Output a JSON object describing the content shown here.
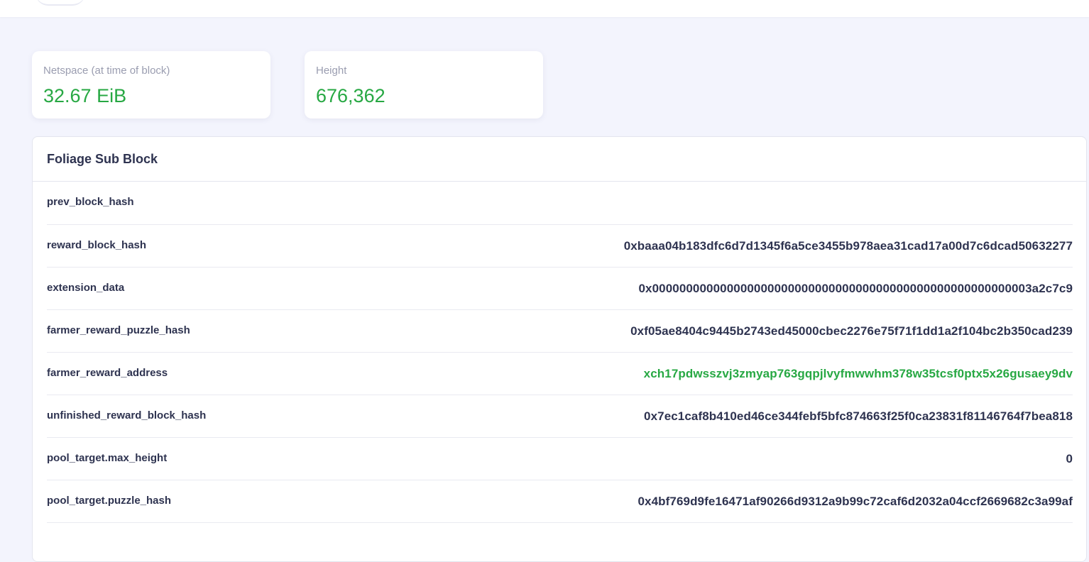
{
  "stats": {
    "netspace": {
      "label": "Netspace (at time of block)",
      "value": "32.67 EiB"
    },
    "height": {
      "label": "Height",
      "value": "676,362"
    }
  },
  "foliage": {
    "title": "Foliage Sub Block",
    "rows": [
      {
        "key": "prev_block_hash",
        "value": ""
      },
      {
        "key": "reward_block_hash",
        "value": "0xbaaa04b183dfc6d7d1345f6a5ce3455b978aea31cad17a00d7c6dcad50632277"
      },
      {
        "key": "extension_data",
        "value": "0x00000000000000000000000000000000000000000000000000000003a2c7c9"
      },
      {
        "key": "farmer_reward_puzzle_hash",
        "value": "0xf05ae8404c9445b2743ed45000cbec2276e75f71f1dd1a2f104bc2b350cad239"
      },
      {
        "key": "farmer_reward_address",
        "value": "xch17pdwsszvj3zmyap763gqpjlvyfmwwhm378w35tcsf0ptx5x26gusaey9dv"
      },
      {
        "key": "unfinished_reward_block_hash",
        "value": "0x7ec1caf8b410ed46ce344febf5bfc874663f25f0ca23831f81146764f7bea818"
      },
      {
        "key": "pool_target.max_height",
        "value": "0"
      },
      {
        "key": "pool_target.puzzle_hash",
        "value": "0x4bf769d9fe16471af90266d9312a9b99c72caf6d2032a04ccf2669682c3a99af"
      }
    ]
  },
  "colors": {
    "accent_green": "#27a843",
    "text_dark": "#2e3350",
    "text_muted": "#9a9db0",
    "background": "#f3f4fd"
  }
}
